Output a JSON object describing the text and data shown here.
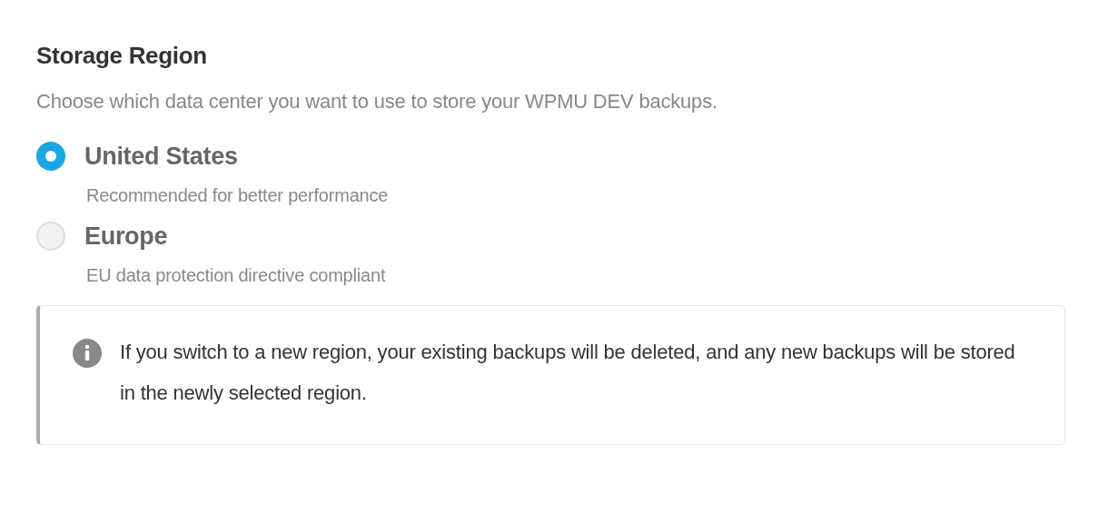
{
  "title": "Storage Region",
  "description": "Choose which data center you want to use to store your WPMU DEV backups.",
  "regions": [
    {
      "label": "United States",
      "description": "Recommended for better performance",
      "selected": true
    },
    {
      "label": "Europe",
      "description": "EU data protection directive compliant",
      "selected": false
    }
  ],
  "notice": {
    "text": "If you switch to a new region, your existing backups will be deleted, and any new backups will be stored in the newly selected region."
  }
}
